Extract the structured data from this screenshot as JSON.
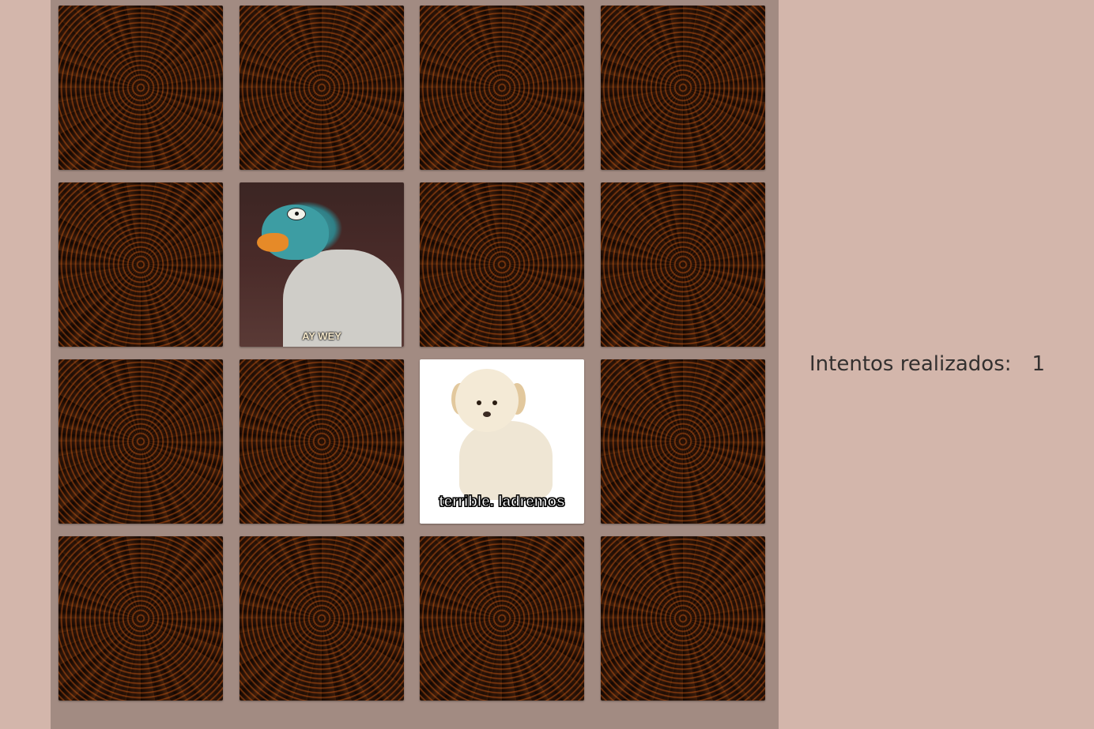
{
  "board": {
    "columns": 4,
    "rows": 4,
    "cards": [
      {
        "state": "hidden"
      },
      {
        "state": "hidden"
      },
      {
        "state": "hidden"
      },
      {
        "state": "hidden"
      },
      {
        "state": "hidden"
      },
      {
        "state": "revealed",
        "image": "perry-platypus-meme",
        "caption": "AY WEY"
      },
      {
        "state": "hidden"
      },
      {
        "state": "hidden"
      },
      {
        "state": "hidden"
      },
      {
        "state": "hidden"
      },
      {
        "state": "revealed",
        "image": "labrador-puppy-meme",
        "caption": "terrible. ladremos"
      },
      {
        "state": "hidden"
      },
      {
        "state": "hidden"
      },
      {
        "state": "hidden"
      },
      {
        "state": "hidden"
      },
      {
        "state": "hidden"
      }
    ]
  },
  "status": {
    "attempts_label": "Intentos realizados:",
    "attempts_count": "1"
  },
  "colors": {
    "page_background": "#d3b6ab",
    "board_background": "#a28b82",
    "text": "#33302f"
  }
}
